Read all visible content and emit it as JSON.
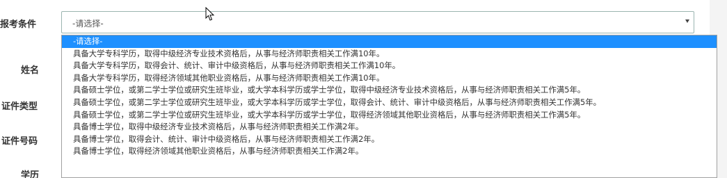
{
  "form": {
    "labels": {
      "condition": "报考条件",
      "name": "姓名",
      "id_type": "证件类型",
      "id_number": "证件号码",
      "education": "学历"
    },
    "condition_select": {
      "value": "-请选择-",
      "options": [
        "-请选择-",
        "具备大学专科学历，取得中级经济专业技术资格后，从事与经济师职责相关工作满10年。",
        "具备大学专科学历，取得会计、统计、审计中级资格后，从事与经济师职责相关工作满10年。",
        "具备大学专科学历，取得经济领域其他职业资格后，从事与经济师职责相关工作满10年。",
        "具备硕士学位，或第二学士学位或研究生班毕业，或大学本科学历或学士学位，取得中级经济专业技术资格后，从事与经济师职责相关工作满5年。",
        "具备硕士学位，或第二学士学位或研究生班毕业，或大学本科学历或学士学位，取得会计、统计、审计中级资格后，从事与经济师职责相关工作满5年。",
        "具备硕士学位，或第二学士学位或研究生班毕业，或大学本科学历或学士学位，取得经济领域其他职业资格后，从事与经济师职责相关工作满5年。",
        "具备博士学位，取得中级经济专业技术资格后，从事与经济师职责相关工作满2年。",
        "具备博士学位，取得会计、统计、审计中级资格后，从事与经济师职责相关工作满2年。",
        "具备博士学位，取得经济领域其他职业资格后，从事与经济师职责相关工作满2年。"
      ]
    }
  },
  "colors": {
    "selected_bg": "#1e90ff",
    "select_border": "#9bb5b0"
  }
}
